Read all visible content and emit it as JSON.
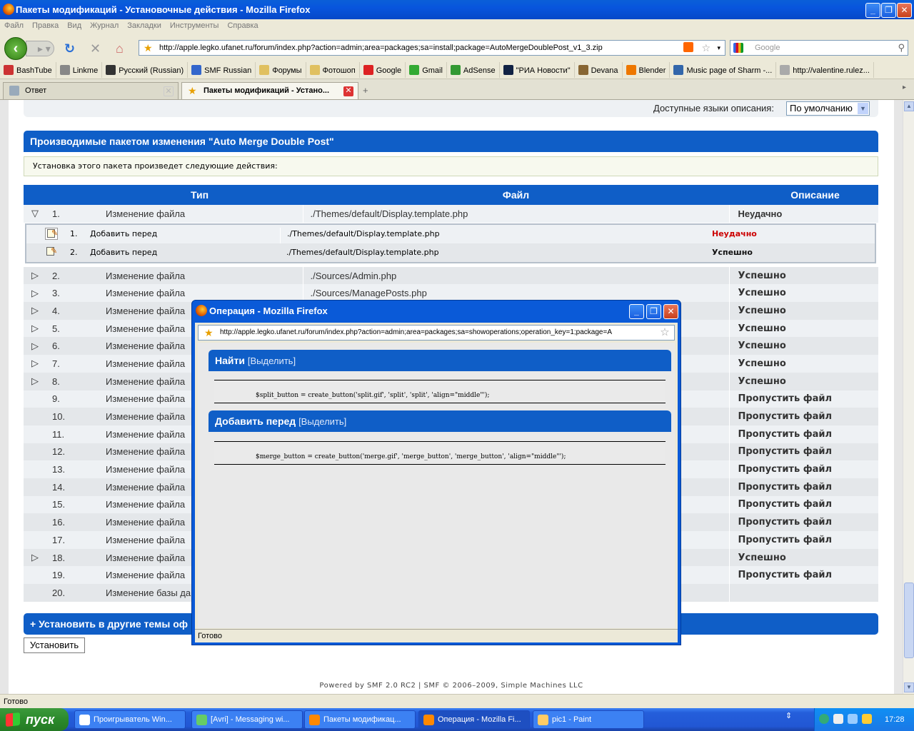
{
  "window": {
    "title": "Пакеты модификаций - Установочные действия - Mozilla Firefox"
  },
  "menu": [
    "Файл",
    "Правка",
    "Вид",
    "Журнал",
    "Закладки",
    "Инструменты",
    "Справка"
  ],
  "nav": {
    "url": "http://apple.legko.ufanet.ru/forum/index.php?action=admin;area=packages;sa=install;package=AutoMergeDoublePost_v1_3.zip",
    "search_placeholder": "Google"
  },
  "bookmarks": [
    {
      "label": "BashTube",
      "color": "#c33"
    },
    {
      "label": "Linkme",
      "color": "#888"
    },
    {
      "label": "Русский (Russian)",
      "color": "#333"
    },
    {
      "label": "SMF Russian",
      "color": "#36c"
    },
    {
      "label": "Форумы",
      "color": "#e0c060"
    },
    {
      "label": "Фотошоп",
      "color": "#e0c060"
    },
    {
      "label": "Google",
      "color": "#d22"
    },
    {
      "label": "Gmail",
      "color": "#3a3"
    },
    {
      "label": "AdSense",
      "color": "#393"
    },
    {
      "label": "\"РИА Новости\"",
      "color": "#124"
    },
    {
      "label": "Devana",
      "color": "#863"
    },
    {
      "label": "Blender",
      "color": "#e70"
    },
    {
      "label": "Music page of Sharm -...",
      "color": "#36a"
    },
    {
      "label": "http://valentine.rulez...",
      "color": "#aaa"
    }
  ],
  "tabs": [
    {
      "label": "Ответ"
    },
    {
      "label": "Пакеты модификаций - Устано..."
    }
  ],
  "page": {
    "lang_label": "Доступные языки описания:",
    "lang_value": "По умолчанию",
    "header": "Производимые пакетом изменения \"Auto Merge Double Post\"",
    "info": "Установка этого пакета произведет следующие действия:",
    "col_type": "Тип",
    "col_file": "Файл",
    "col_desc": "Описание",
    "rows": [
      {
        "num": "1.",
        "type": "Изменение файла",
        "file": "./Themes/default/Display.template.php",
        "desc": "Неудачно",
        "status": "fail",
        "arrow": "▽"
      },
      {
        "num": "2.",
        "type": "Изменение файла",
        "file": "./Sources/Admin.php",
        "desc": "Успешно",
        "status": "ok",
        "arrow": "▷"
      },
      {
        "num": "3.",
        "type": "Изменение файла",
        "file": "./Sources/ManagePosts.php",
        "desc": "Успешно",
        "status": "ok",
        "arrow": "▷"
      },
      {
        "num": "4.",
        "type": "Изменение файла",
        "file": "",
        "desc": "Успешно",
        "status": "ok",
        "arrow": "▷"
      },
      {
        "num": "5.",
        "type": "Изменение файла",
        "file": "",
        "desc": "Успешно",
        "status": "ok",
        "arrow": "▷"
      },
      {
        "num": "6.",
        "type": "Изменение файла",
        "file": "",
        "desc": "Успешно",
        "status": "ok",
        "arrow": "▷"
      },
      {
        "num": "7.",
        "type": "Изменение файла",
        "file": "",
        "desc": "Успешно",
        "status": "ok",
        "arrow": "▷"
      },
      {
        "num": "8.",
        "type": "Изменение файла",
        "file": "",
        "desc": "Успешно",
        "status": "ok",
        "arrow": "▷"
      },
      {
        "num": "9.",
        "type": "Изменение файла",
        "file": "",
        "desc": "Пропустить файл",
        "status": "skip",
        "arrow": ""
      },
      {
        "num": "10.",
        "type": "Изменение файла",
        "file": "",
        "desc": "Пропустить файл",
        "status": "skip",
        "arrow": ""
      },
      {
        "num": "11.",
        "type": "Изменение файла",
        "file": "",
        "desc": "Пропустить файл",
        "status": "skip",
        "arrow": ""
      },
      {
        "num": "12.",
        "type": "Изменение файла",
        "file": "",
        "desc": "Пропустить файл",
        "status": "skip",
        "arrow": ""
      },
      {
        "num": "13.",
        "type": "Изменение файла",
        "file": "",
        "desc": "Пропустить файл",
        "status": "skip",
        "arrow": ""
      },
      {
        "num": "14.",
        "type": "Изменение файла",
        "file": "",
        "desc": "Пропустить файл",
        "status": "skip",
        "arrow": ""
      },
      {
        "num": "15.",
        "type": "Изменение файла",
        "file": "",
        "desc": "Пропустить файл",
        "status": "skip",
        "arrow": ""
      },
      {
        "num": "16.",
        "type": "Изменение файла",
        "file": "",
        "desc": "Пропустить файл",
        "status": "skip",
        "arrow": ""
      },
      {
        "num": "17.",
        "type": "Изменение файла",
        "file": "",
        "desc": "Пропустить файл",
        "status": "skip",
        "arrow": ""
      },
      {
        "num": "18.",
        "type": "Изменение файла",
        "file": "",
        "desc": "Успешно",
        "status": "ok",
        "arrow": "▷"
      },
      {
        "num": "19.",
        "type": "Изменение файла",
        "file": "",
        "desc": "Пропустить файл",
        "status": "skip",
        "arrow": ""
      },
      {
        "num": "20.",
        "type": "Изменение базы данны",
        "file": "",
        "desc": "",
        "status": "",
        "arrow": ""
      }
    ],
    "subrows": [
      {
        "num": "1.",
        "type": "Добавить перед",
        "file": "./Themes/default/Display.template.php",
        "desc": "Неудачно",
        "status": "fail"
      },
      {
        "num": "2.",
        "type": "Добавить перед",
        "file": "./Themes/default/Display.template.php",
        "desc": "Успешно",
        "status": "ok"
      }
    ],
    "other_themes": "Установить в другие темы оф",
    "install_button": "Установить",
    "footer": "Powered by SMF 2.0 RC2 | SMF © 2006–2009, Simple Machines LLC"
  },
  "popup": {
    "title": "Операция - Mozilla Firefox",
    "url": "http://apple.legko.ufanet.ru/forum/index.php?action=admin;area=packages;sa=showoperations;operation_key=1;package=A",
    "find_label": "Найти",
    "select_label": "[Выделить]",
    "find_code": "$split_button = create_button('split.gif', 'split', 'split', 'align=\"middle\"');",
    "add_label": "Добавить перед",
    "add_code": "$merge_button = create_button('merge.gif', 'merge_button', 'merge_button', 'align=\"middle\"');",
    "status": "Готово"
  },
  "status": "Готово",
  "taskbar": {
    "start": "пуск",
    "tasks": [
      {
        "label": "Проигрыватель Win...",
        "color": "#fff"
      },
      {
        "label": "[Avri] - Messaging wi...",
        "color": "#6c6"
      },
      {
        "label": "Пакеты модификац...",
        "color": "#f80"
      },
      {
        "label": "Операция - Mozilla Fi...",
        "color": "#f80"
      },
      {
        "label": "pic1 - Paint",
        "color": "#fc6"
      }
    ],
    "clock": "17:28"
  }
}
